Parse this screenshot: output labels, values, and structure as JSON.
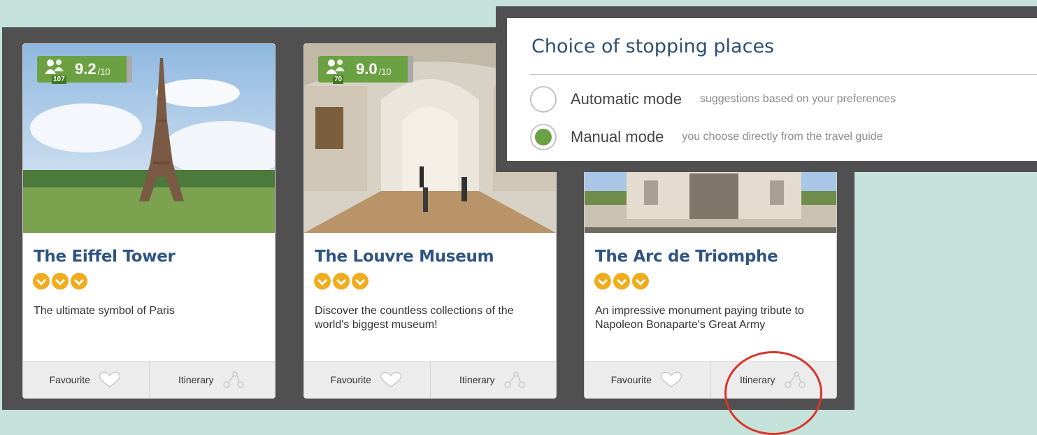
{
  "cards": [
    {
      "title": "The Eiffel Tower",
      "review_count": "107",
      "score": "9.2",
      "score_max": "/10",
      "stars": 3,
      "description": "The ultimate symbol of Paris",
      "favourite_label": "Favourite",
      "itinerary_label": "Itinerary",
      "image": "eiffel-tower-photo"
    },
    {
      "title": "The Louvre Museum",
      "review_count": "70",
      "score": "9.0",
      "score_max": "/10",
      "stars": 3,
      "description": "Discover the countless collections of the world's biggest museum!",
      "favourite_label": "Favourite",
      "itinerary_label": "Itinerary",
      "image": "louvre-gallery-photo"
    },
    {
      "title": "The Arc de Triomphe",
      "stars": 3,
      "description": "An impressive monument paying tribute to Napoleon Bonaparte's Great Army",
      "favourite_label": "Favourite",
      "itinerary_label": "Itinerary",
      "image": "arc-de-triomphe-photo"
    }
  ],
  "popup": {
    "title": "Choice of stopping places",
    "options": [
      {
        "label": "Automatic mode",
        "hint": "suggestions based on your preferences",
        "selected": false
      },
      {
        "label": "Manual mode",
        "hint": "you choose directly from the travel guide",
        "selected": true
      }
    ]
  },
  "colors": {
    "background": "#c5e2da",
    "panel": "#505050",
    "title_blue": "#2e5482",
    "rating_green": "#6ca143",
    "star_orange": "#f0ac1d",
    "highlight_red": "#d9352a"
  }
}
